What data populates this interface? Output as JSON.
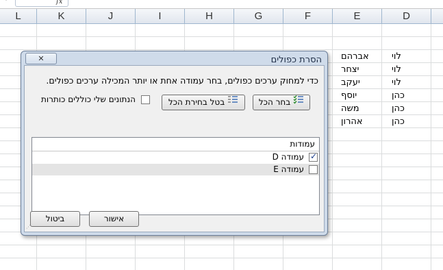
{
  "formula_bar": {
    "name_box": "▾",
    "fx": "fx"
  },
  "columns": [
    "L",
    "K",
    "J",
    "I",
    "H",
    "G",
    "F",
    "E",
    "D"
  ],
  "sheet": {
    "rows": [
      {
        "d": "לוי",
        "e": "אברהם"
      },
      {
        "d": "לוי",
        "e": "יצחר"
      },
      {
        "d": "לוי",
        "e": "יעקב"
      },
      {
        "d": "כהן",
        "e": "יוסף"
      },
      {
        "d": "כהן",
        "e": "משה"
      },
      {
        "d": "כהן",
        "e": "אהרון"
      }
    ]
  },
  "dialog": {
    "title": "הסרת כפולים",
    "close_label": "✕",
    "instruction": "כדי למחוק ערכים כפולים, בחר עמודה אחת או יותר המכילה ערכים כפולים.",
    "select_all_label": "בחר הכל",
    "unselect_all_label": "בטל בחירת הכל",
    "headers_checkbox_label": "הנתונים שלי כוללים כותרות",
    "headers_checked": false,
    "list_header": "עמודות",
    "columns": [
      {
        "label": "עמודה D",
        "checked": true
      },
      {
        "label": "עמודה E",
        "checked": false
      }
    ],
    "ok_label": "אישור",
    "cancel_label": "ביטול"
  }
}
